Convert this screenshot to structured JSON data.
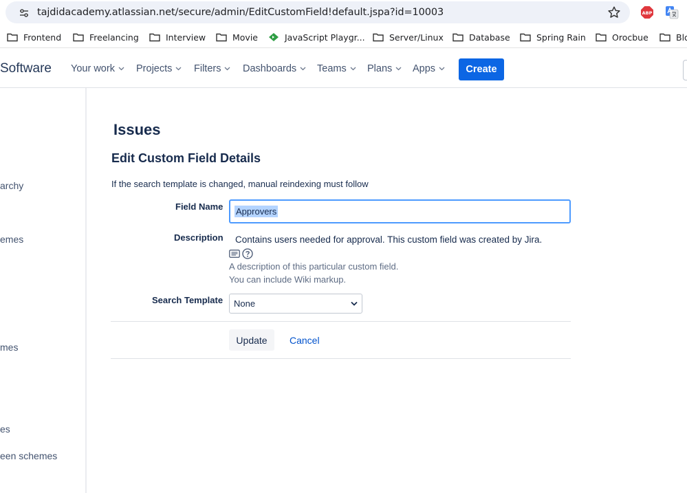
{
  "browser": {
    "url": "tajdidacademy.atlassian.net/secure/admin/EditCustomField!default.jspa?id=10003",
    "abp_label": "ABP"
  },
  "bookmarks": [
    {
      "label": "Frontend",
      "icon": "folder-icon"
    },
    {
      "label": "Freelancing",
      "icon": "folder-icon"
    },
    {
      "label": "Interview",
      "icon": "folder-icon"
    },
    {
      "label": "Movie",
      "icon": "folder-icon"
    },
    {
      "label": "JavaScript Playgr...",
      "icon": "playground-icon"
    },
    {
      "label": "Server/Linux",
      "icon": "folder-icon"
    },
    {
      "label": "Database",
      "icon": "folder-icon"
    },
    {
      "label": "Spring Rain",
      "icon": "folder-icon"
    },
    {
      "label": "Orocbue",
      "icon": "folder-icon"
    },
    {
      "label": "Blo",
      "icon": "folder-icon"
    }
  ],
  "topnav": {
    "brand": "Software",
    "items": [
      "Your work",
      "Projects",
      "Filters",
      "Dashboards",
      "Teams",
      "Plans",
      "Apps"
    ],
    "create_label": "Create",
    "accent": "#0c66e4"
  },
  "sidebar": {
    "items": [
      "archy",
      "emes",
      "mes",
      "es",
      "een schemes"
    ]
  },
  "main": {
    "page_title": "Issues",
    "section_title": "Edit Custom Field Details",
    "warning": "If the search template is changed, manual reindexing must follow",
    "field_name_label": "Field Name",
    "field_name_value": "Approvers",
    "description_label": "Description",
    "description_value": "Contains users needed for approval. This custom field was created by Jira.",
    "description_hint_1": "A description of this particular custom field.",
    "description_hint_2": "You can include Wiki markup.",
    "search_template_label": "Search Template",
    "search_template_value": "None",
    "update_label": "Update",
    "cancel_label": "Cancel"
  }
}
